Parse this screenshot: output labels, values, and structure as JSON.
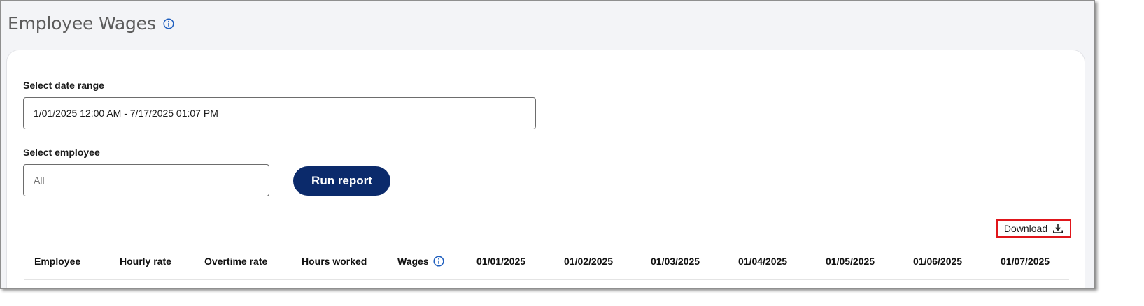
{
  "page": {
    "title": "Employee Wages"
  },
  "filters": {
    "date_range_label": "Select date range",
    "date_range_value": "1/01/2025 12:00 AM - 7/17/2025 01:07 PM",
    "employee_label": "Select employee",
    "employee_value": "All"
  },
  "actions": {
    "run_report_label": "Run report",
    "download_label": "Download"
  },
  "table": {
    "columns": [
      "Employee",
      "Hourly rate",
      "Overtime rate",
      "Hours worked",
      "Wages",
      "01/01/2025",
      "01/02/2025",
      "01/03/2025",
      "01/04/2025",
      "01/05/2025",
      "01/06/2025",
      "01/07/2025"
    ]
  },
  "icons": {
    "title_info": "info-icon",
    "wages_info": "info-icon",
    "download": "download-icon"
  },
  "colors": {
    "primary_button": "#0b2a6b",
    "info_icon": "#1f5fbf",
    "download_highlight": "#e0161b"
  }
}
